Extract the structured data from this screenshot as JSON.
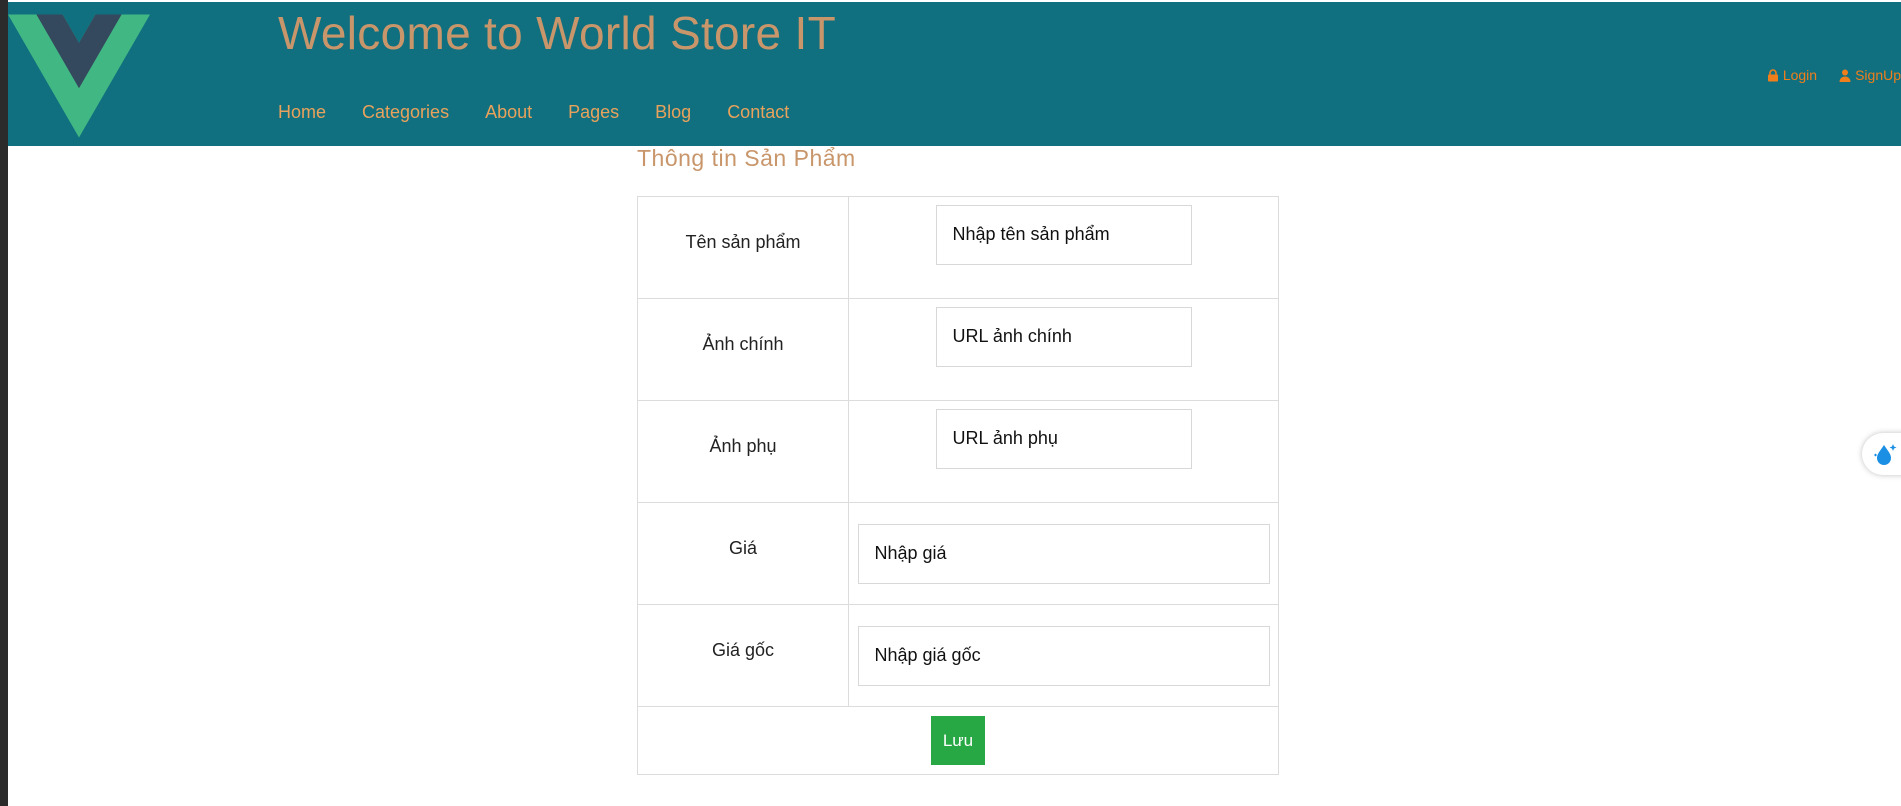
{
  "header": {
    "title": "Welcome to World Store IT",
    "nav": [
      "Home",
      "Categories",
      "About",
      "Pages",
      "Blog",
      "Contact"
    ],
    "login": "Login",
    "signup": "SignUp"
  },
  "form": {
    "title": "Thông tin Sản Phẩm",
    "rows": [
      {
        "label": "Tên sản phẩm",
        "placeholder": "Nhập tên sản phẩm"
      },
      {
        "label": "Ảnh chính",
        "placeholder": "URL ảnh chính"
      },
      {
        "label": "Ảnh phụ",
        "placeholder": "URL ảnh phụ"
      },
      {
        "label": "Giá",
        "placeholder": "Nhập giá"
      },
      {
        "label": "Giá gốc",
        "placeholder": "Nhập giá gốc"
      }
    ],
    "save_label": "Lưu"
  },
  "colors": {
    "header_bg": "#11707f",
    "title": "#c8966a",
    "nav": "#e9a25c",
    "auth": "#f07e1b",
    "save_button": "#28a745"
  },
  "icons": [
    "vue-logo-icon",
    "lock-icon",
    "user-icon",
    "water-drop-icon"
  ]
}
